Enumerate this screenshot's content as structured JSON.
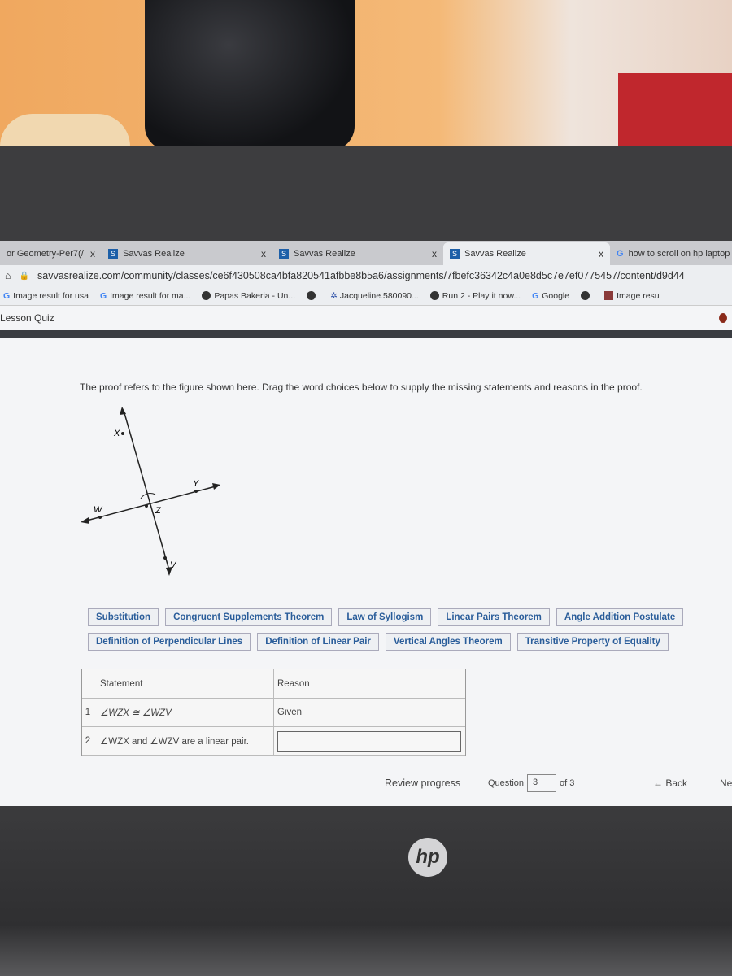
{
  "browser": {
    "tabs": [
      {
        "label": "or Geometry-Per7(/",
        "active": false
      },
      {
        "label": "Savvas Realize",
        "active": false
      },
      {
        "label": "Savvas Realize",
        "active": false
      },
      {
        "label": "Savvas Realize",
        "active": true
      },
      {
        "label": "how to scroll on hp laptop",
        "active": false
      }
    ],
    "close_glyph": "x",
    "url": "savvasrealize.com/community/classes/ce6f430508ca4bfa820541afbbe8b5a6/assignments/7fbefc36342c4a0e8d5c7e7ef0775457/content/d9d44",
    "bookmarks": [
      {
        "icon": "google-icon",
        "label": "Image result for usa"
      },
      {
        "icon": "google-icon",
        "label": "Image result for ma..."
      },
      {
        "icon": "globe-icon",
        "label": "Papas Bakeria - Un..."
      },
      {
        "icon": "globe-icon",
        "label": ""
      },
      {
        "icon": "gear-icon",
        "label": "Jacqueline.580090..."
      },
      {
        "icon": "game-icon",
        "label": "Run 2 - Play it now..."
      },
      {
        "icon": "google-icon",
        "label": "Google"
      },
      {
        "icon": "globe-icon",
        "label": ""
      },
      {
        "icon": "image-icon",
        "label": "Image resu"
      }
    ]
  },
  "page": {
    "title": "Lesson Quiz",
    "prompt": "The proof refers to the figure shown here. Drag the word choices below to supply the missing statements and reasons in the proof.",
    "figure_labels": {
      "x": "X",
      "y": "Y",
      "w": "W",
      "z": "Z",
      "v": "V"
    },
    "choices_row1": [
      "Substitution",
      "Congruent Supplements Theorem",
      "Law of Syllogism",
      "Linear Pairs Theorem",
      "Angle Addition Postulate"
    ],
    "choices_row2": [
      "Definition of Perpendicular Lines",
      "Definition of Linear Pair",
      "Vertical Angles Theorem",
      "Transitive Property of Equality"
    ],
    "proof": {
      "headers": {
        "statement": "Statement",
        "reason": "Reason"
      },
      "rows": [
        {
          "num": "1",
          "statement": "∠WZX ≅ ∠WZV",
          "reason": "Given"
        },
        {
          "num": "2",
          "statement": "∠WZX and ∠WZV are a linear pair.",
          "reason": ""
        }
      ]
    },
    "footer": {
      "review": "Review progress",
      "question_label": "Question",
      "question_value": "3",
      "of": "of 3",
      "back": "← Back",
      "next": "Ne"
    }
  },
  "laptop_logo": "hp"
}
